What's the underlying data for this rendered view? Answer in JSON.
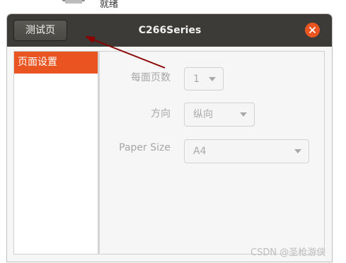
{
  "background": {
    "status_text": "就绪"
  },
  "dialog": {
    "title": "C266Series",
    "test_page_button": "测试页",
    "close_icon": "close-icon",
    "accent_color": "#e95420",
    "titlebar_color": "#3c3b37"
  },
  "sidebar": {
    "items": [
      {
        "label": "页面设置",
        "selected": true
      }
    ]
  },
  "page_setup": {
    "pages_per_side": {
      "label": "每面页数",
      "value": "1"
    },
    "orientation": {
      "label": "方向",
      "value": "纵向"
    },
    "paper_size": {
      "label": "Paper Size",
      "value": "A4"
    }
  },
  "watermark": "CSDN @圣枪游侠",
  "annotation": {
    "arrow_color": "#8b0000"
  }
}
